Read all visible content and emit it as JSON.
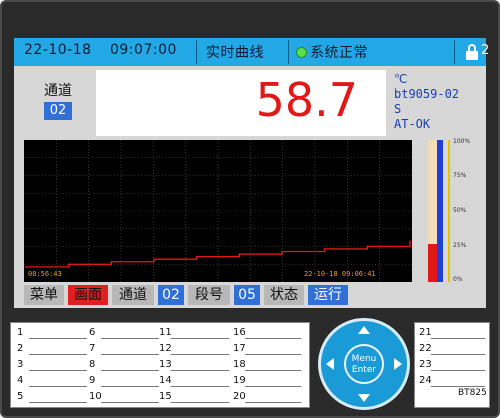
{
  "header": {
    "date": "22-10-18",
    "time": "09:07:00",
    "title": "实时曲线",
    "status": "系统正常",
    "lock_count": "2"
  },
  "channel": {
    "label": "通道",
    "number": "02",
    "value": "58.7",
    "unit": "℃",
    "tag": "bt9059-02",
    "line3": "S",
    "mode": "AT-OK"
  },
  "chart": {
    "start_time": "08:56:43",
    "end_time": "22-10-18 09:06:41"
  },
  "chart_data": {
    "type": "line",
    "x": [
      "08:56:43",
      "08:58:00",
      "08:59:00",
      "09:00:00",
      "09:01:00",
      "09:02:00",
      "09:03:00",
      "09:04:00",
      "09:05:00",
      "09:06:41"
    ],
    "series": [
      {
        "values": [
          4,
          6,
          8,
          10,
          12,
          14,
          16,
          18,
          20,
          24
        ]
      }
    ],
    "ylim": [
      0,
      100
    ],
    "grid": true,
    "line_color": "#e01818"
  },
  "gauge": {
    "ticks": [
      "100%",
      "75%",
      "50%",
      "25%",
      "0%"
    ],
    "fill_percent": 27
  },
  "menu": [
    {
      "label": "菜单",
      "style": "gray"
    },
    {
      "label": "画面",
      "style": "red"
    },
    {
      "label": "通道",
      "style": "gray"
    },
    {
      "label": "02",
      "style": "blue"
    },
    {
      "label": "段号",
      "style": "gray"
    },
    {
      "label": "05",
      "style": "blue"
    },
    {
      "label": "状态",
      "style": "gray"
    },
    {
      "label": "运行",
      "style": "blue"
    }
  ],
  "label_slots_left": [
    "1",
    "2",
    "3",
    "4",
    "5",
    "6",
    "7",
    "8",
    "9",
    "10",
    "11",
    "12",
    "13",
    "14",
    "15",
    "16",
    "17",
    "18",
    "19",
    "20"
  ],
  "label_slots_right": [
    "21",
    "22",
    "23",
    "24"
  ],
  "pad": {
    "center": "Menu Enter"
  },
  "model": "BT825",
  "colors": {
    "header": "#23a8e6",
    "value": "#e01818",
    "accent_blue": "#2f6fd6"
  }
}
